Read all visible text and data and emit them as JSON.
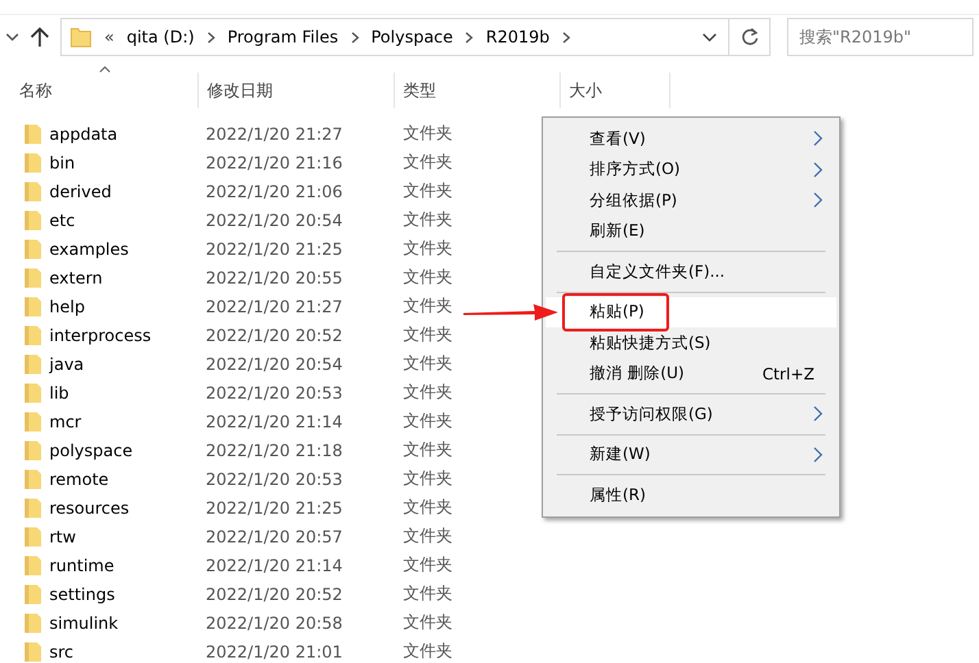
{
  "address_bar": {
    "segments": [
      "qita (D:)",
      "Program Files",
      "Polyspace",
      "R2019b"
    ],
    "overflow": "«"
  },
  "search": {
    "placeholder": "搜索\"R2019b\""
  },
  "columns": [
    "名称",
    "修改日期",
    "类型",
    "大小"
  ],
  "rows": [
    {
      "name": "appdata",
      "modified": "2022/1/20 21:27",
      "type": "文件夹"
    },
    {
      "name": "bin",
      "modified": "2022/1/20 21:16",
      "type": "文件夹"
    },
    {
      "name": "derived",
      "modified": "2022/1/20 21:06",
      "type": "文件夹"
    },
    {
      "name": "etc",
      "modified": "2022/1/20 20:54",
      "type": "文件夹"
    },
    {
      "name": "examples",
      "modified": "2022/1/20 21:25",
      "type": "文件夹"
    },
    {
      "name": "extern",
      "modified": "2022/1/20 20:55",
      "type": "文件夹"
    },
    {
      "name": "help",
      "modified": "2022/1/20 21:27",
      "type": "文件夹"
    },
    {
      "name": "interprocess",
      "modified": "2022/1/20 20:52",
      "type": "文件夹"
    },
    {
      "name": "java",
      "modified": "2022/1/20 20:54",
      "type": "文件夹"
    },
    {
      "name": "lib",
      "modified": "2022/1/20 20:53",
      "type": "文件夹"
    },
    {
      "name": "mcr",
      "modified": "2022/1/20 21:14",
      "type": "文件夹"
    },
    {
      "name": "polyspace",
      "modified": "2022/1/20 21:18",
      "type": "文件夹"
    },
    {
      "name": "remote",
      "modified": "2022/1/20 20:53",
      "type": "文件夹"
    },
    {
      "name": "resources",
      "modified": "2022/1/20 21:25",
      "type": "文件夹"
    },
    {
      "name": "rtw",
      "modified": "2022/1/20 20:57",
      "type": "文件夹"
    },
    {
      "name": "runtime",
      "modified": "2022/1/20 21:14",
      "type": "文件夹"
    },
    {
      "name": "settings",
      "modified": "2022/1/20 20:52",
      "type": "文件夹"
    },
    {
      "name": "simulink",
      "modified": "2022/1/20 20:58",
      "type": "文件夹"
    },
    {
      "name": "src",
      "modified": "2022/1/20 21:01",
      "type": "文件夹"
    }
  ],
  "context_menu": [
    {
      "kind": "item",
      "label": "查看(V)",
      "submenu": true,
      "selected": false
    },
    {
      "kind": "item",
      "label": "排序方式(O)",
      "submenu": true,
      "selected": false
    },
    {
      "kind": "item",
      "label": "分组依据(P)",
      "submenu": true,
      "selected": false
    },
    {
      "kind": "item",
      "label": "刷新(E)",
      "submenu": false,
      "selected": false
    },
    {
      "kind": "separator"
    },
    {
      "kind": "item",
      "label": "自定义文件夹(F)...",
      "submenu": false,
      "selected": false
    },
    {
      "kind": "separator"
    },
    {
      "kind": "item",
      "label": "粘贴(P)",
      "submenu": false,
      "selected": true,
      "annotated": true
    },
    {
      "kind": "item",
      "label": "粘贴快捷方式(S)",
      "submenu": false,
      "selected": false
    },
    {
      "kind": "item",
      "label": "撤消 删除(U)",
      "shortcut": "Ctrl+Z",
      "submenu": false,
      "selected": false
    },
    {
      "kind": "separator"
    },
    {
      "kind": "item",
      "label": "授予访问权限(G)",
      "submenu": true,
      "selected": false
    },
    {
      "kind": "separator"
    },
    {
      "kind": "item",
      "label": "新建(W)",
      "submenu": true,
      "selected": false
    },
    {
      "kind": "separator"
    },
    {
      "kind": "item",
      "label": "属性(R)",
      "submenu": false,
      "selected": false
    }
  ]
}
